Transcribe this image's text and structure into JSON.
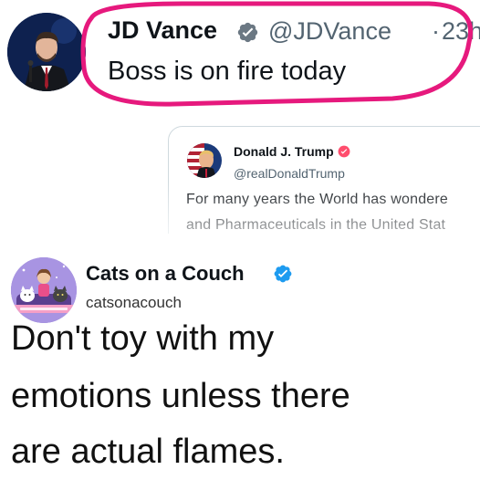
{
  "top_tweet": {
    "author_name": "JD Vance",
    "handle": "@JDVance",
    "separator": "·",
    "time": "23h",
    "text": "Boss is on fire today",
    "highlight_color": "#e6197d",
    "quoted": {
      "author_name": "Donald J. Trump",
      "handle": "@realDonaldTrump",
      "line1": "For many years the World has wondere",
      "line2": "and Pharmaceuticals in the United Stat"
    }
  },
  "bottom_post": {
    "author_name": "Cats on a Couch",
    "handle": "catsonacouch",
    "lines": [
      "Don't toy with my",
      "emotions unless there",
      "are actual flames."
    ]
  },
  "colors": {
    "verified_blue": "#1d9bf0",
    "affiliate_badge": "#ff4d6d",
    "secondary_text": "#536471"
  }
}
